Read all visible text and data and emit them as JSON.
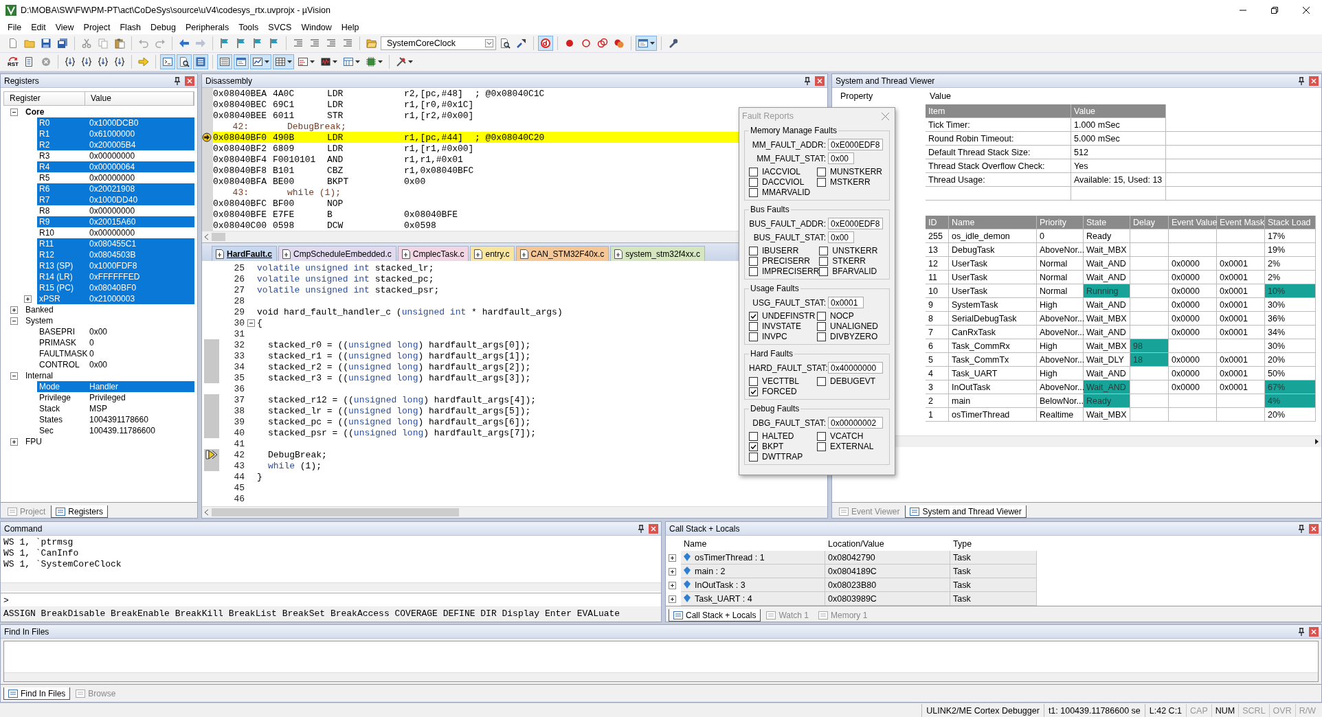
{
  "window": {
    "title": "D:\\MOBA\\SW\\FW\\PM-PT\\act\\CoDeSys\\source\\uV4\\codesys_rtx.uvprojx - µVision"
  },
  "menu": [
    "File",
    "Edit",
    "View",
    "Project",
    "Flash",
    "Debug",
    "Peripherals",
    "Tools",
    "SVCS",
    "Window",
    "Help"
  ],
  "toolbars": [
    [
      {
        "kind": "page",
        "pressed": false
      },
      {
        "kind": "folder",
        "pressed": false
      },
      {
        "kind": "floppy",
        "pressed": false
      },
      {
        "kind": "floppies",
        "pressed": false
      },
      {
        "kind": "separator"
      },
      {
        "kind": "scissors",
        "pressed": false
      },
      {
        "kind": "copy",
        "pressed": false
      },
      {
        "kind": "clipboard",
        "pressed": false
      },
      {
        "kind": "separator"
      },
      {
        "kind": "undo",
        "pressed": false
      },
      {
        "kind": "redo",
        "pressed": false
      },
      {
        "kind": "separator"
      },
      {
        "kind": "arrow-left",
        "pressed": false
      },
      {
        "kind": "arrow-right",
        "pressed": false
      },
      {
        "kind": "separator"
      },
      {
        "kind": "flag",
        "pressed": false
      },
      {
        "kind": "flag",
        "pressed": false
      },
      {
        "kind": "flag",
        "pressed": false
      },
      {
        "kind": "flag",
        "pressed": false
      },
      {
        "kind": "separator"
      },
      {
        "kind": "indent",
        "pressed": false
      },
      {
        "kind": "indent",
        "pressed": false
      },
      {
        "kind": "indent",
        "pressed": false
      },
      {
        "kind": "indent",
        "pressed": false
      },
      {
        "kind": "separator"
      },
      {
        "kind": "open-folder",
        "pressed": false
      },
      {
        "kind": "combo",
        "value": "SystemCoreClock"
      },
      {
        "kind": "doc-search",
        "pressed": false
      },
      {
        "kind": "pointer",
        "pressed": false
      },
      {
        "kind": "separator"
      },
      {
        "kind": "debug",
        "pressed": true
      },
      {
        "kind": "separator"
      },
      {
        "kind": "dot",
        "pressed": false
      },
      {
        "kind": "ring",
        "pressed": false
      },
      {
        "kind": "rings",
        "pressed": false
      },
      {
        "kind": "dot-cross",
        "pressed": false
      },
      {
        "kind": "separator"
      },
      {
        "kind": "window",
        "pressed": true,
        "menu": true
      },
      {
        "kind": "separator"
      },
      {
        "kind": "wrench",
        "pressed": false
      }
    ],
    [
      {
        "kind": "reset",
        "label": "RST"
      },
      {
        "kind": "list-doc",
        "pressed": false
      },
      {
        "kind": "stop",
        "pressed": false
      },
      {
        "kind": "separator"
      },
      {
        "kind": "step",
        "pressed": false
      },
      {
        "kind": "step",
        "pressed": false
      },
      {
        "kind": "step",
        "pressed": false
      },
      {
        "kind": "step",
        "pressed": false
      },
      {
        "kind": "separator"
      },
      {
        "kind": "arrow-yellow",
        "pressed": false
      },
      {
        "kind": "separator"
      },
      {
        "kind": "terminal",
        "pressed": true
      },
      {
        "kind": "doc-search",
        "pressed": true
      },
      {
        "kind": "stack",
        "pressed": true
      },
      {
        "kind": "separator"
      },
      {
        "kind": "lines",
        "pressed": true
      },
      {
        "kind": "window",
        "pressed": true
      },
      {
        "kind": "chart",
        "pressed": true,
        "menu": true
      },
      {
        "kind": "grid",
        "pressed": true,
        "menu": true
      },
      {
        "kind": "trace",
        "pressed": false,
        "menu": true
      },
      {
        "kind": "chart-bar",
        "pressed": false,
        "menu": true
      },
      {
        "kind": "memory",
        "pressed": false,
        "menu": true
      },
      {
        "kind": "chip",
        "pressed": false,
        "menu": true
      },
      {
        "kind": "separator"
      },
      {
        "kind": "tools",
        "pressed": false,
        "menu": true
      }
    ]
  ],
  "registers": {
    "title": "Registers",
    "columns": [
      "Register",
      "Value"
    ],
    "tree": [
      {
        "name": "Core",
        "bold": true,
        "expanded": true,
        "children": [
          {
            "name": "R0",
            "value": "0x1000DCB0",
            "changed": true
          },
          {
            "name": "R1",
            "value": "0x61000000",
            "changed": true
          },
          {
            "name": "R2",
            "value": "0x200005B4",
            "changed": true
          },
          {
            "name": "R3",
            "value": "0x00000000",
            "changed": false
          },
          {
            "name": "R4",
            "value": "0x00000064",
            "changed": true
          },
          {
            "name": "R5",
            "value": "0x00000000",
            "changed": false
          },
          {
            "name": "R6",
            "value": "0x20021908",
            "changed": true
          },
          {
            "name": "R7",
            "value": "0x1000DD40",
            "changed": true
          },
          {
            "name": "R8",
            "value": "0x00000000",
            "changed": false
          },
          {
            "name": "R9",
            "value": "0x20015A60",
            "changed": true
          },
          {
            "name": "R10",
            "value": "0x00000000",
            "changed": false
          },
          {
            "name": "R11",
            "value": "0x080455C1",
            "changed": true
          },
          {
            "name": "R12",
            "value": "0x0804503B",
            "changed": true
          },
          {
            "name": "R13 (SP)",
            "value": "0x1000FDF8",
            "changed": true
          },
          {
            "name": "R14 (LR)",
            "value": "0xFFFFFFED",
            "changed": true
          },
          {
            "name": "R15 (PC)",
            "value": "0x08040BF0",
            "changed": true
          },
          {
            "name": "xPSR",
            "value": "0x21000003",
            "changed": true,
            "expanded": false
          }
        ]
      },
      {
        "name": "Banked",
        "bold": false,
        "expanded": false
      },
      {
        "name": "System",
        "bold": false,
        "expanded": true,
        "children": [
          {
            "name": "BASEPRI",
            "value": "0x00",
            "changed": false
          },
          {
            "name": "PRIMASK",
            "value": "0",
            "changed": false
          },
          {
            "name": "FAULTMASK",
            "value": "0",
            "changed": false
          },
          {
            "name": "CONTROL",
            "value": "0x00",
            "changed": false
          }
        ]
      },
      {
        "name": "Internal",
        "bold": false,
        "expanded": true,
        "children": [
          {
            "name": "Mode",
            "value": "Handler",
            "changed": true
          },
          {
            "name": "Privilege",
            "value": "Privileged",
            "changed": false
          },
          {
            "name": "Stack",
            "value": "MSP",
            "changed": false
          },
          {
            "name": "States",
            "value": "1004391178660",
            "changed": false
          },
          {
            "name": "Sec",
            "value": "100439.11786600",
            "changed": false
          }
        ]
      },
      {
        "name": "FPU",
        "bold": false,
        "expanded": false
      }
    ],
    "tabs": [
      {
        "label": "Project",
        "selected": false
      },
      {
        "label": "Registers",
        "selected": true
      }
    ]
  },
  "disassembly": {
    "title": "Disassembly",
    "lines": [
      {
        "kind": "asm",
        "address": "0x08040BEA",
        "opcode": "4A0C",
        "mnemonic": "LDR",
        "operands": "r2,[pc,#48]",
        "comment": "; @0x08040C1C",
        "current": false
      },
      {
        "kind": "asm",
        "address": "0x08040BEC",
        "opcode": "69C1",
        "mnemonic": "LDR",
        "operands": "r1,[r0,#0x1C]",
        "current": false
      },
      {
        "kind": "asm",
        "address": "0x08040BEE",
        "opcode": "6011",
        "mnemonic": "STR",
        "operands": "r1,[r2,#0x00]",
        "current": false
      },
      {
        "kind": "source",
        "number": "42:",
        "code": "DebugBreak;",
        "current": false
      },
      {
        "kind": "asm",
        "address": "0x08040BF0",
        "opcode": "490B",
        "mnemonic": "LDR",
        "operands": "r1,[pc,#44]",
        "comment": "; @0x08040C20",
        "current": true
      },
      {
        "kind": "asm",
        "address": "0x08040BF2",
        "opcode": "6809",
        "mnemonic": "LDR",
        "operands": "r1,[r1,#0x00]",
        "current": false
      },
      {
        "kind": "asm",
        "address": "0x08040BF4",
        "opcode": "F0010101",
        "mnemonic": "AND",
        "operands": "r1,r1,#0x01",
        "current": false
      },
      {
        "kind": "asm",
        "address": "0x08040BF8",
        "opcode": "B101",
        "mnemonic": "CBZ",
        "operands": "r1,0x08040BFC",
        "current": false
      },
      {
        "kind": "asm",
        "address": "0x08040BFA",
        "opcode": "BE00",
        "mnemonic": "BKPT",
        "operands": "0x00",
        "current": false
      },
      {
        "kind": "source",
        "number": "43:",
        "code": "while (1);",
        "current": false
      },
      {
        "kind": "asm",
        "address": "0x08040BFC",
        "opcode": "BF00",
        "mnemonic": "NOP",
        "current": false
      },
      {
        "kind": "asm",
        "address": "0x08040BFE",
        "opcode": "E7FE",
        "mnemonic": "B",
        "operands": "0x08040BFE",
        "current": false
      },
      {
        "kind": "asm",
        "address": "0x08040C00",
        "opcode": "0598",
        "mnemonic": "DCW",
        "operands": "0x0598",
        "current": false
      }
    ]
  },
  "editor": {
    "tabs": [
      {
        "label": "HardFault.c",
        "selected": true,
        "color": "#c7d8ef"
      },
      {
        "label": "CmpScheduleEmbedded.c",
        "selected": false,
        "color": "#e2dbf0"
      },
      {
        "label": "CmplecTask.c",
        "selected": false,
        "color": "#f3d6e4"
      },
      {
        "label": "entry.c",
        "selected": false,
        "color": "#f8e5a0"
      },
      {
        "label": "CAN_STM32F40x.c",
        "selected": false,
        "color": "#f5c796"
      },
      {
        "label": "system_stm32f4xx.c",
        "selected": false,
        "color": "#d6e6c0"
      }
    ],
    "lines": [
      {
        "number": "25",
        "segments": [
          {
            "kind": "keyword",
            "text": "volatile unsigned int"
          },
          {
            "kind": "plain",
            "text": " stacked_lr;"
          }
        ],
        "indented": false,
        "executable": false,
        "current": false,
        "fold": false
      },
      {
        "number": "26",
        "segments": [
          {
            "kind": "keyword",
            "text": "volatile unsigned int"
          },
          {
            "kind": "plain",
            "text": " stacked_pc;"
          }
        ],
        "indented": false,
        "executable": false,
        "current": false,
        "fold": false
      },
      {
        "number": "27",
        "segments": [
          {
            "kind": "keyword",
            "text": "volatile unsigned int"
          },
          {
            "kind": "plain",
            "text": " stacked_psr;"
          }
        ],
        "indented": false,
        "executable": false,
        "current": false,
        "fold": false
      },
      {
        "number": "28",
        "indented": false,
        "executable": false,
        "current": false,
        "fold": false
      },
      {
        "number": "29",
        "segments": [
          {
            "kind": "plain",
            "text": "void hard_fault_handler_c ("
          },
          {
            "kind": "keyword",
            "text": "unsigned int"
          },
          {
            "kind": "plain",
            "text": " * hardfault_args)"
          }
        ],
        "indented": false,
        "executable": false,
        "current": false,
        "fold": false
      },
      {
        "number": "30",
        "segments": [
          {
            "kind": "plain",
            "text": "{"
          }
        ],
        "indented": false,
        "executable": false,
        "current": false,
        "fold": true
      },
      {
        "number": "31",
        "indented": false,
        "executable": false,
        "current": false,
        "fold": false
      },
      {
        "number": "32",
        "segments": [
          {
            "kind": "plain",
            "text": "stacked_r0 = (("
          },
          {
            "kind": "keyword",
            "text": "unsigned long"
          },
          {
            "kind": "plain",
            "text": ") hardfault_args[0]);"
          }
        ],
        "indented": true,
        "executable": true,
        "current": false,
        "fold": false
      },
      {
        "number": "33",
        "segments": [
          {
            "kind": "plain",
            "text": "stacked_r1 = (("
          },
          {
            "kind": "keyword",
            "text": "unsigned long"
          },
          {
            "kind": "plain",
            "text": ") hardfault_args[1]);"
          }
        ],
        "indented": true,
        "executable": true,
        "current": false,
        "fold": false
      },
      {
        "number": "34",
        "segments": [
          {
            "kind": "plain",
            "text": "stacked_r2 = (("
          },
          {
            "kind": "keyword",
            "text": "unsigned long"
          },
          {
            "kind": "plain",
            "text": ") hardfault_args[2]);"
          }
        ],
        "indented": true,
        "executable": true,
        "current": false,
        "fold": false
      },
      {
        "number": "35",
        "segments": [
          {
            "kind": "plain",
            "text": "stacked_r3 = (("
          },
          {
            "kind": "keyword",
            "text": "unsigned long"
          },
          {
            "kind": "plain",
            "text": ") hardfault_args[3]);"
          }
        ],
        "indented": true,
        "executable": true,
        "current": false,
        "fold": false
      },
      {
        "number": "36",
        "indented": false,
        "executable": false,
        "current": false,
        "fold": false
      },
      {
        "number": "37",
        "segments": [
          {
            "kind": "plain",
            "text": "stacked_r12 = (("
          },
          {
            "kind": "keyword",
            "text": "unsigned long"
          },
          {
            "kind": "plain",
            "text": ") hardfault_args[4]);"
          }
        ],
        "indented": true,
        "executable": true,
        "current": false,
        "fold": false
      },
      {
        "number": "38",
        "segments": [
          {
            "kind": "plain",
            "text": "stacked_lr = (("
          },
          {
            "kind": "keyword",
            "text": "unsigned long"
          },
          {
            "kind": "plain",
            "text": ") hardfault_args[5]);"
          }
        ],
        "indented": true,
        "executable": true,
        "current": false,
        "fold": false
      },
      {
        "number": "39",
        "segments": [
          {
            "kind": "plain",
            "text": "stacked_pc = (("
          },
          {
            "kind": "keyword",
            "text": "unsigned long"
          },
          {
            "kind": "plain",
            "text": ") hardfault_args[6]);"
          }
        ],
        "indented": true,
        "executable": true,
        "current": false,
        "fold": false
      },
      {
        "number": "40",
        "segments": [
          {
            "kind": "plain",
            "text": "stacked_psr = (("
          },
          {
            "kind": "keyword",
            "text": "unsigned long"
          },
          {
            "kind": "plain",
            "text": ") hardfault_args[7]);"
          }
        ],
        "indented": true,
        "executable": true,
        "current": false,
        "fold": false
      },
      {
        "number": "41",
        "indented": false,
        "executable": false,
        "current": false,
        "fold": false
      },
      {
        "number": "42",
        "segments": [
          {
            "kind": "plain",
            "text": "DebugBreak;"
          }
        ],
        "indented": true,
        "executable": true,
        "current": true,
        "fold": false
      },
      {
        "number": "43",
        "segments": [
          {
            "kind": "keyword",
            "text": "while"
          },
          {
            "kind": "plain",
            "text": " (1);"
          }
        ],
        "indented": true,
        "executable": true,
        "current": false,
        "fold": false
      },
      {
        "number": "44",
        "segments": [
          {
            "kind": "plain",
            "text": "}"
          }
        ],
        "indented": false,
        "executable": false,
        "current": false,
        "fold": false
      },
      {
        "number": "45",
        "indented": false,
        "executable": false,
        "current": false,
        "fold": false
      },
      {
        "number": "46",
        "indented": false,
        "executable": false,
        "current": false,
        "fold": false
      }
    ]
  },
  "fault_reports": {
    "title": "Fault Reports",
    "groups": [
      {
        "title": "Memory Manage Faults",
        "fields": [
          {
            "label": "MM_FAULT_ADDR:",
            "value": "0xE000EDF8"
          },
          {
            "label": "MM_FAULT_STAT:",
            "value": "0x00"
          }
        ],
        "flags": [
          {
            "label": "IACCVIOL",
            "checked": false
          },
          {
            "label": "MUNSTKERR",
            "checked": false
          },
          {
            "label": "DACCVIOL",
            "checked": false
          },
          {
            "label": "MSTKERR",
            "checked": false
          },
          {
            "label": "MMARVALID",
            "checked": false
          }
        ]
      },
      {
        "title": "Bus Faults",
        "fields": [
          {
            "label": "BUS_FAULT_ADDR:",
            "value": "0xE000EDF8"
          },
          {
            "label": "BUS_FAULT_STAT:",
            "value": "0x00"
          }
        ],
        "flags": [
          {
            "label": "IBUSERR",
            "checked": false
          },
          {
            "label": "UNSTKERR",
            "checked": false
          },
          {
            "label": "PRECISERR",
            "checked": false
          },
          {
            "label": "STKERR",
            "checked": false
          },
          {
            "label": "IMPRECISERR",
            "checked": false
          },
          {
            "label": "BFARVALID",
            "checked": false
          }
        ]
      },
      {
        "title": "Usage Faults",
        "fields": [
          {
            "label": "USG_FAULT_STAT:",
            "value": "0x0001"
          }
        ],
        "flags": [
          {
            "label": "UNDEFINSTR",
            "checked": true
          },
          {
            "label": "NOCP",
            "checked": false
          },
          {
            "label": "INVSTATE",
            "checked": false
          },
          {
            "label": "UNALIGNED",
            "checked": false
          },
          {
            "label": "INVPC",
            "checked": false
          },
          {
            "label": "DIVBYZERO",
            "checked": false
          }
        ]
      },
      {
        "title": "Hard Faults",
        "fields": [
          {
            "label": "HARD_FAULT_STAT:",
            "value": "0x40000000"
          }
        ],
        "flags": [
          {
            "label": "VECTTBL",
            "checked": false
          },
          {
            "label": "DEBUGEVT",
            "checked": false
          },
          {
            "label": "FORCED",
            "checked": true
          }
        ]
      },
      {
        "title": "Debug Faults",
        "fields": [
          {
            "label": "DBG_FAULT_STAT:",
            "value": "0x00000002"
          }
        ],
        "flags": [
          {
            "label": "HALTED",
            "checked": false
          },
          {
            "label": "VCATCH",
            "checked": false
          },
          {
            "label": "BKPT",
            "checked": true
          },
          {
            "label": "EXTERNAL",
            "checked": false
          },
          {
            "label": "DWTTRAP",
            "checked": false
          }
        ]
      }
    ]
  },
  "thread_viewer": {
    "title": "System and Thread Viewer",
    "columns": [
      "Property",
      "Value"
    ],
    "info": {
      "columns": [
        "Item",
        "Value"
      ],
      "rows": [
        [
          "Tick Timer:",
          "1.000 mSec"
        ],
        [
          "Round Robin Timeout:",
          "5.000 mSec"
        ],
        [
          "Default Thread Stack Size:",
          "512"
        ],
        [
          "Thread Stack Overflow Check:",
          "Yes"
        ],
        [
          "Thread Usage:",
          "Available: 15, Used: 13"
        ]
      ]
    },
    "threads": {
      "columns": [
        "ID",
        "Name",
        "Priority",
        "State",
        "Delay",
        "Event Value",
        "Event Mask",
        "Stack Load"
      ],
      "rows": [
        {
          "id": "255",
          "name": "os_idle_demon",
          "priority": "0",
          "state": "Ready",
          "stack_load": "17%",
          "state_marked": false,
          "delay_marked": false,
          "load_marked": false
        },
        {
          "id": "13",
          "name": "DebugTask",
          "priority": "AboveNor...",
          "state": "Wait_MBX",
          "stack_load": "19%",
          "state_marked": false,
          "delay_marked": false,
          "load_marked": false
        },
        {
          "id": "12",
          "name": "UserTask",
          "priority": "Normal",
          "state": "Wait_AND",
          "event_value": "0x0000",
          "event_mask": "0x0001",
          "stack_load": "2%",
          "state_marked": false,
          "delay_marked": false,
          "load_marked": false
        },
        {
          "id": "11",
          "name": "UserTask",
          "priority": "Normal",
          "state": "Wait_AND",
          "event_value": "0x0000",
          "event_mask": "0x0001",
          "stack_load": "2%",
          "state_marked": false,
          "delay_marked": false,
          "load_marked": false
        },
        {
          "id": "10",
          "name": "UserTask",
          "priority": "Normal",
          "state": "Running",
          "event_value": "0x0000",
          "event_mask": "0x0001",
          "stack_load": "10%",
          "state_marked": true,
          "delay_marked": false,
          "load_marked": true
        },
        {
          "id": "9",
          "name": "SystemTask",
          "priority": "High",
          "state": "Wait_AND",
          "event_value": "0x0000",
          "event_mask": "0x0001",
          "stack_load": "30%",
          "state_marked": false,
          "delay_marked": false,
          "load_marked": false
        },
        {
          "id": "8",
          "name": "SerialDebugTask",
          "priority": "AboveNor...",
          "state": "Wait_MBX",
          "event_value": "0x0000",
          "event_mask": "0x0001",
          "stack_load": "36%",
          "state_marked": false,
          "delay_marked": false,
          "load_marked": false
        },
        {
          "id": "7",
          "name": "CanRxTask",
          "priority": "AboveNor...",
          "state": "Wait_AND",
          "event_value": "0x0000",
          "event_mask": "0x0001",
          "stack_load": "34%",
          "state_marked": false,
          "delay_marked": false,
          "load_marked": false
        },
        {
          "id": "6",
          "name": "Task_CommRx",
          "priority": "High",
          "state": "Wait_MBX",
          "delay": "98",
          "stack_load": "30%",
          "state_marked": false,
          "delay_marked": true,
          "load_marked": false
        },
        {
          "id": "5",
          "name": "Task_CommTx",
          "priority": "AboveNor...",
          "state": "Wait_DLY",
          "delay": "18",
          "event_value": "0x0000",
          "event_mask": "0x0001",
          "stack_load": "20%",
          "state_marked": false,
          "delay_marked": true,
          "load_marked": false
        },
        {
          "id": "4",
          "name": "Task_UART",
          "priority": "High",
          "state": "Wait_AND",
          "event_value": "0x0000",
          "event_mask": "0x0001",
          "stack_load": "50%",
          "state_marked": false,
          "delay_marked": false,
          "load_marked": false
        },
        {
          "id": "3",
          "name": "InOutTask",
          "priority": "AboveNor...",
          "state": "Wait_AND",
          "event_value": "0x0000",
          "event_mask": "0x0001",
          "stack_load": "67%",
          "state_marked": true,
          "delay_marked": false,
          "load_marked": true
        },
        {
          "id": "2",
          "name": "main",
          "priority": "BelowNor...",
          "state": "Ready",
          "stack_load": "4%",
          "state_marked": true,
          "delay_marked": false,
          "load_marked": true
        },
        {
          "id": "1",
          "name": "osTimerThread",
          "priority": "Realtime",
          "state": "Wait_MBX",
          "stack_load": "20%",
          "state_marked": false,
          "delay_marked": false,
          "load_marked": false
        }
      ]
    },
    "tabs": [
      {
        "label": "Event Viewer",
        "selected": false
      },
      {
        "label": "System and Thread Viewer",
        "selected": true
      }
    ]
  },
  "command": {
    "title": "Command",
    "output": [
      "WS 1, `ptrmsg",
      "WS 1, `CanInfo",
      "WS 1, `SystemCoreClock"
    ],
    "prompt": ">",
    "help": "ASSIGN BreakDisable BreakEnable BreakKill BreakList BreakSet BreakAccess COVERAGE DEFINE DIR Display Enter EVALuate"
  },
  "call_stack": {
    "title": "Call Stack + Locals",
    "columns": [
      "Name",
      "Location/Value",
      "Type"
    ],
    "rows": [
      {
        "name": "osTimerThread : 1",
        "location": "0x08042790",
        "type": "Task"
      },
      {
        "name": "main : 2",
        "location": "0x0804189C",
        "type": "Task"
      },
      {
        "name": "InOutTask : 3",
        "location": "0x08023B80",
        "type": "Task"
      },
      {
        "name": "Task_UART : 4",
        "location": "0x0803989C",
        "type": "Task"
      }
    ],
    "tabs": [
      {
        "label": "Call Stack + Locals",
        "selected": true
      },
      {
        "label": "Watch 1",
        "selected": false
      },
      {
        "label": "Memory 1",
        "selected": false
      }
    ]
  },
  "find_in_files": {
    "title": "Find In Files",
    "tabs": [
      {
        "label": "Find In Files",
        "selected": true
      },
      {
        "label": "Browse",
        "selected": false
      }
    ]
  },
  "status_bar": {
    "items": [
      "ULINK2/ME Cortex Debugger",
      "t1: 100439.11786600 se",
      "L:42 C:1"
    ],
    "indicators": [
      {
        "label": "CAP",
        "on": false
      },
      {
        "label": "NUM",
        "on": true
      },
      {
        "label": "SCRL",
        "on": false
      },
      {
        "label": "OVR",
        "on": false
      },
      {
        "label": "R/W",
        "on": false
      }
    ]
  }
}
